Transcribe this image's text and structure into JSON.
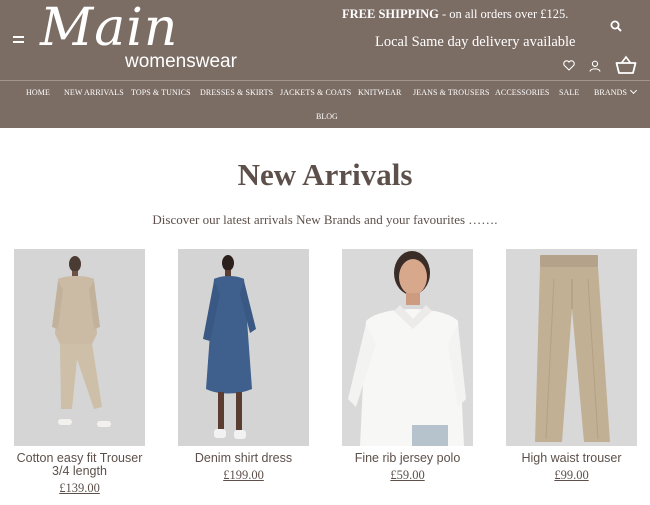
{
  "brand": {
    "name": "Main",
    "tagline": "womenswear"
  },
  "header": {
    "shipping_bold": "FREE SHIPPING",
    "shipping_rest": " - on all orders over £125.",
    "delivery": "Local Same day delivery available",
    "icons": [
      "menu-icon",
      "search-icon",
      "heart-icon",
      "user-icon",
      "basket-icon"
    ]
  },
  "nav": {
    "items": [
      "HOME",
      "NEW ARRIVALS",
      "TOPS & TUNICS",
      "DRESSES & SKIRTS",
      "JACKETS & COATS",
      "KNITWEAR",
      "JEANS & TROUSERS",
      "ACCESSORIES",
      "SALE",
      "BRANDS",
      "BLOG"
    ]
  },
  "page": {
    "title": "New Arrivals",
    "intro": "Discover our latest arrivals New Brands and your favourites ……."
  },
  "products": [
    {
      "name": "Cotton easy fit Trouser 3/4 length",
      "price": "£139.00"
    },
    {
      "name": "Denim shirt dress",
      "price": "£199.00"
    },
    {
      "name": "Fine rib jersey polo",
      "price": "£59.00"
    },
    {
      "name": "High waist trouser",
      "price": "£99.00"
    }
  ],
  "colors": {
    "header_bg": "#7b6c64",
    "text": "#5d504a",
    "photo_bg": "#d6d6d6"
  }
}
